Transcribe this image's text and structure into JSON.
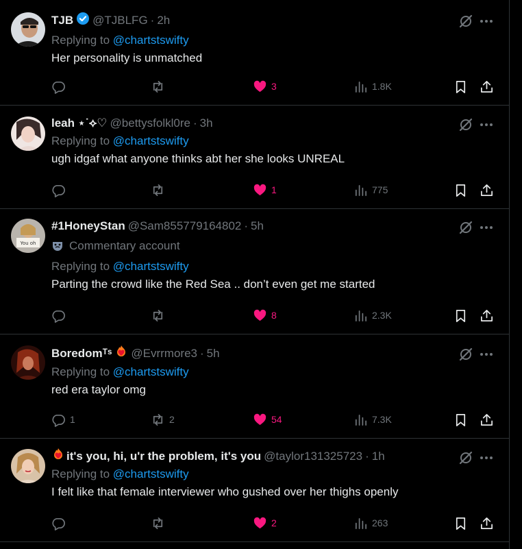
{
  "colors": {
    "background": "#000000",
    "text": "#e7e9ea",
    "muted": "#71767b",
    "link": "#1d9bf0",
    "like": "#f91880",
    "border": "#2f3336"
  },
  "replying_label": "Replying to",
  "posts": [
    {
      "name": "TJB",
      "verified": true,
      "handle": "@TJBLFG",
      "time": "2h",
      "reply_to": "@chartstswifty",
      "text": "Her personality is unmatched",
      "replies": "",
      "reposts": "",
      "likes": "3",
      "views": "1.8K"
    },
    {
      "name": "leah ⋆˙⟡♡",
      "handle": "@bettysfolkl0re",
      "time": "3h",
      "reply_to": "@chartstswifty",
      "text": "ugh idgaf what anyone thinks abt her she looks UNREAL",
      "replies": "",
      "reposts": "",
      "likes": "1",
      "views": "775"
    },
    {
      "name": "#1HoneyStan",
      "handle": "@Sam855779164802",
      "time": "5h",
      "label": "Commentary account",
      "reply_to": "@chartstswifty",
      "text": "Parting the crowd like the Red Sea .. don’t even get me started",
      "replies": "",
      "reposts": "",
      "likes": "8",
      "views": "2.3K"
    },
    {
      "name": "Boredomᵀˢ",
      "handle": "@Evrrmore3",
      "time": "5h",
      "reply_to": "@chartstswifty",
      "text": "red era taylor omg",
      "replies": "1",
      "reposts": "2",
      "likes": "54",
      "views": "7.3K"
    },
    {
      "name": "it's you, hi, u'r the problem, it's you",
      "handle": "@taylor131325723",
      "time": "1h",
      "reply_to": "@chartstswifty",
      "text": "I felt like that female interviewer who gushed over her thighs openly",
      "replies": "",
      "reposts": "",
      "likes": "2",
      "views": "263"
    }
  ]
}
